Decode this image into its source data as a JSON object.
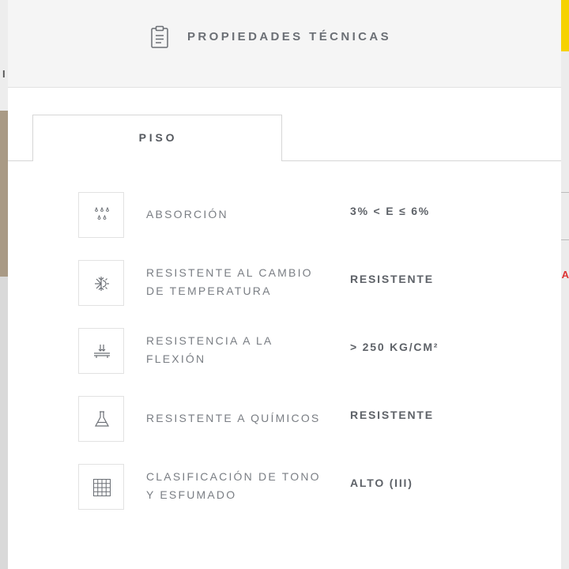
{
  "header": {
    "title": "PROPIEDADES TÉCNICAS",
    "icon": "clipboard-icon"
  },
  "tabs": [
    {
      "label": "PISO",
      "active": true
    }
  ],
  "properties": [
    {
      "icon": "water-drops-icon",
      "label_lines": [
        "ABSORCIÓN"
      ],
      "value": "3% < E ≤ 6%"
    },
    {
      "icon": "snowflake-sun-icon",
      "label_lines": [
        "RESISTENTE AL CAMBIO",
        "DE TEMPERATURA"
      ],
      "value": "RESISTENTE"
    },
    {
      "icon": "flexion-press-icon",
      "label_lines": [
        "RESISTENCIA A LA",
        "FLEXIÓN"
      ],
      "value": "> 250 KG/CM²"
    },
    {
      "icon": "flask-icon",
      "label_lines": [
        "RESISTENTE A QUÍMICOS"
      ],
      "value": "RESISTENTE"
    },
    {
      "icon": "grid-icon",
      "label_lines": [
        "CLASIFICACIÓN DE TONO",
        "Y ESFUMADO"
      ],
      "value": "ALTO (III)"
    }
  ],
  "background": {
    "left_letter": "I",
    "right_letter": "A"
  },
  "colors": {
    "accent_yellow": "#f6d200",
    "text_gray": "#6b6f75",
    "border_gray": "#d6d6d6"
  }
}
